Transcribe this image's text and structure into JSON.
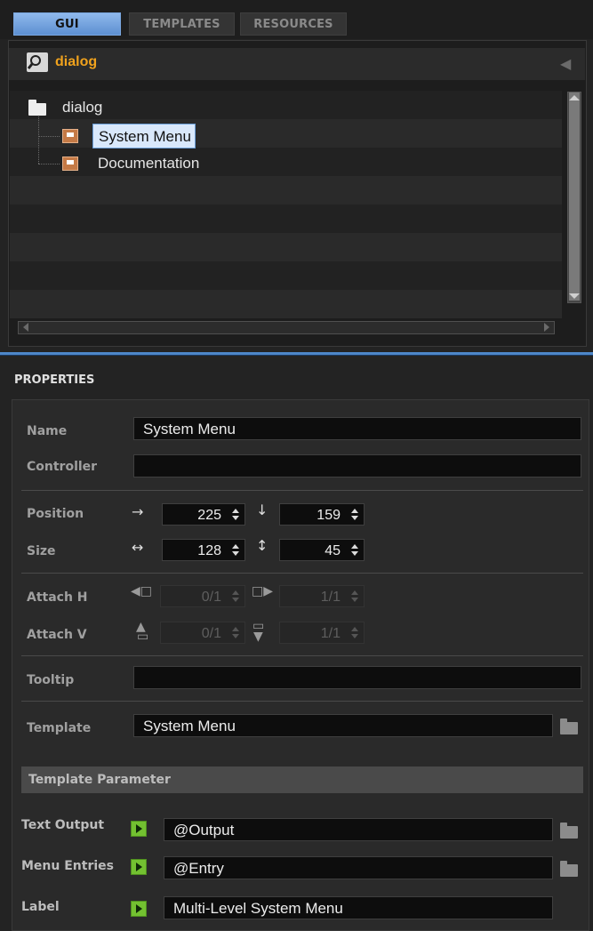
{
  "tabs": [
    "GUI",
    "TEMPLATES",
    "RESOURCES"
  ],
  "browser": {
    "path": "dialog",
    "tree": [
      {
        "label": "dialog",
        "type": "folder"
      },
      {
        "label": "System Menu",
        "type": "item",
        "selected": true
      },
      {
        "label": "Documentation",
        "type": "item"
      }
    ]
  },
  "properties": {
    "title": "PROPERTIES",
    "labels": {
      "name": "Name",
      "controller": "Controller",
      "position": "Position",
      "size": "Size",
      "attach_h": "Attach H",
      "attach_v": "Attach V",
      "tooltip": "Tooltip",
      "template": "Template"
    },
    "name_value": "System Menu",
    "controller_value": "",
    "position": {
      "x": "225",
      "y": "159"
    },
    "size": {
      "w": "128",
      "h": "45"
    },
    "attach_h": {
      "left": "0/1",
      "right": "1/1"
    },
    "attach_v": {
      "top": "0/1",
      "bottom": "1/1"
    },
    "tooltip_value": "",
    "template_value": "System Menu",
    "template_parameter_header": "Template Parameter",
    "template_params": [
      {
        "label": "Text Output",
        "value": "@Output"
      },
      {
        "label": "Menu Entries",
        "value": "@Entry"
      },
      {
        "label": "Label",
        "value": "Multi-Level System Menu"
      }
    ]
  },
  "colors": {
    "accent": "#5d8fd1",
    "path": "#f0a21d",
    "play": "#73c131"
  },
  "icons": [
    "search-icon",
    "back-arrow-icon",
    "folder-icon",
    "template-item-icon",
    "play-icon",
    "folder-open-icon",
    "arrow-right-icon",
    "arrow-down-icon",
    "resize-horizontal-icon",
    "resize-vertical-icon"
  ]
}
